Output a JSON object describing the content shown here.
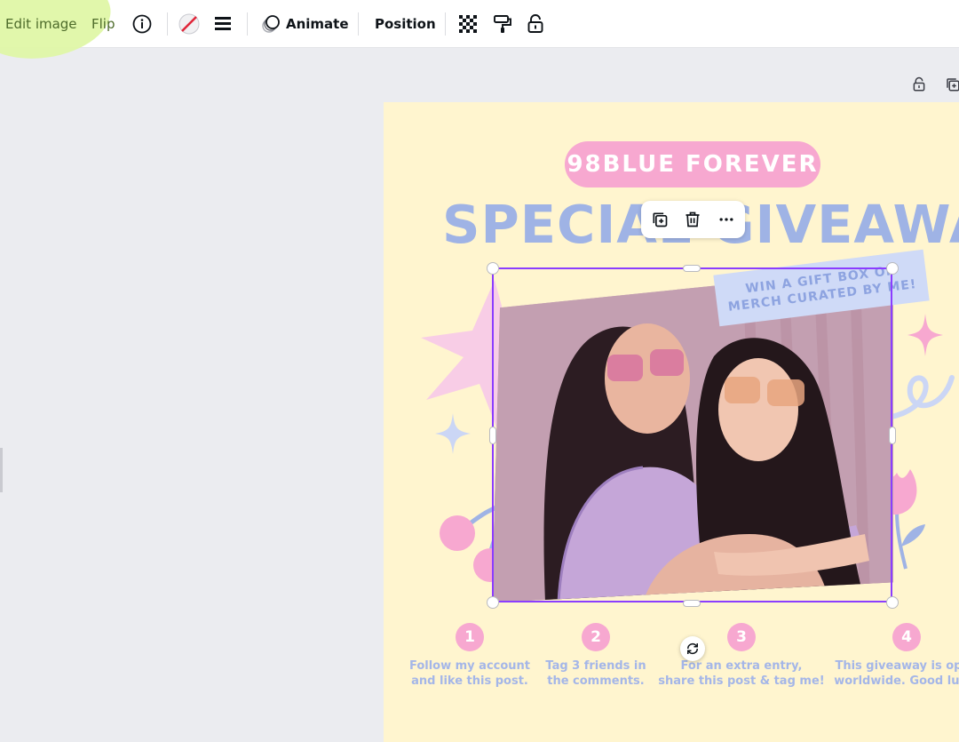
{
  "toolbar": {
    "edit_image_label": "Edit image",
    "flip_label": "Flip",
    "animate_label": "Animate",
    "position_label": "Position",
    "icons": [
      "info-icon",
      "color-icon",
      "border-style-icon",
      "animate-icon",
      "transparency-icon",
      "copy-style-icon",
      "lock-icon"
    ],
    "highlight_color": "#dff7a6"
  },
  "design": {
    "badge_text": "98BLUE FOREVER",
    "headline": "SPECIAL GIVEAWAY",
    "sticker_line1": "WIN A GIFT BOX OF",
    "sticker_line2": "MERCH CURATED BY ME!",
    "steps": [
      {
        "num": "1",
        "line1": "Follow my account",
        "line2": "and like this post."
      },
      {
        "num": "2",
        "line1": "Tag 3 friends in",
        "line2": "the comments."
      },
      {
        "num": "3",
        "line1": "For an extra entry,",
        "line2": "share this post & tag me!"
      },
      {
        "num": "4",
        "line1": "This giveaway is open",
        "line2": "worldwide. Good luck!"
      }
    ],
    "colors": {
      "background": "#fff5cf",
      "pink": "#f7a8d0",
      "blue": "#9fb3e5",
      "selection": "#8b3dff"
    }
  },
  "element_menu": {
    "icons": [
      "duplicate-icon",
      "delete-icon",
      "more-icon"
    ]
  }
}
